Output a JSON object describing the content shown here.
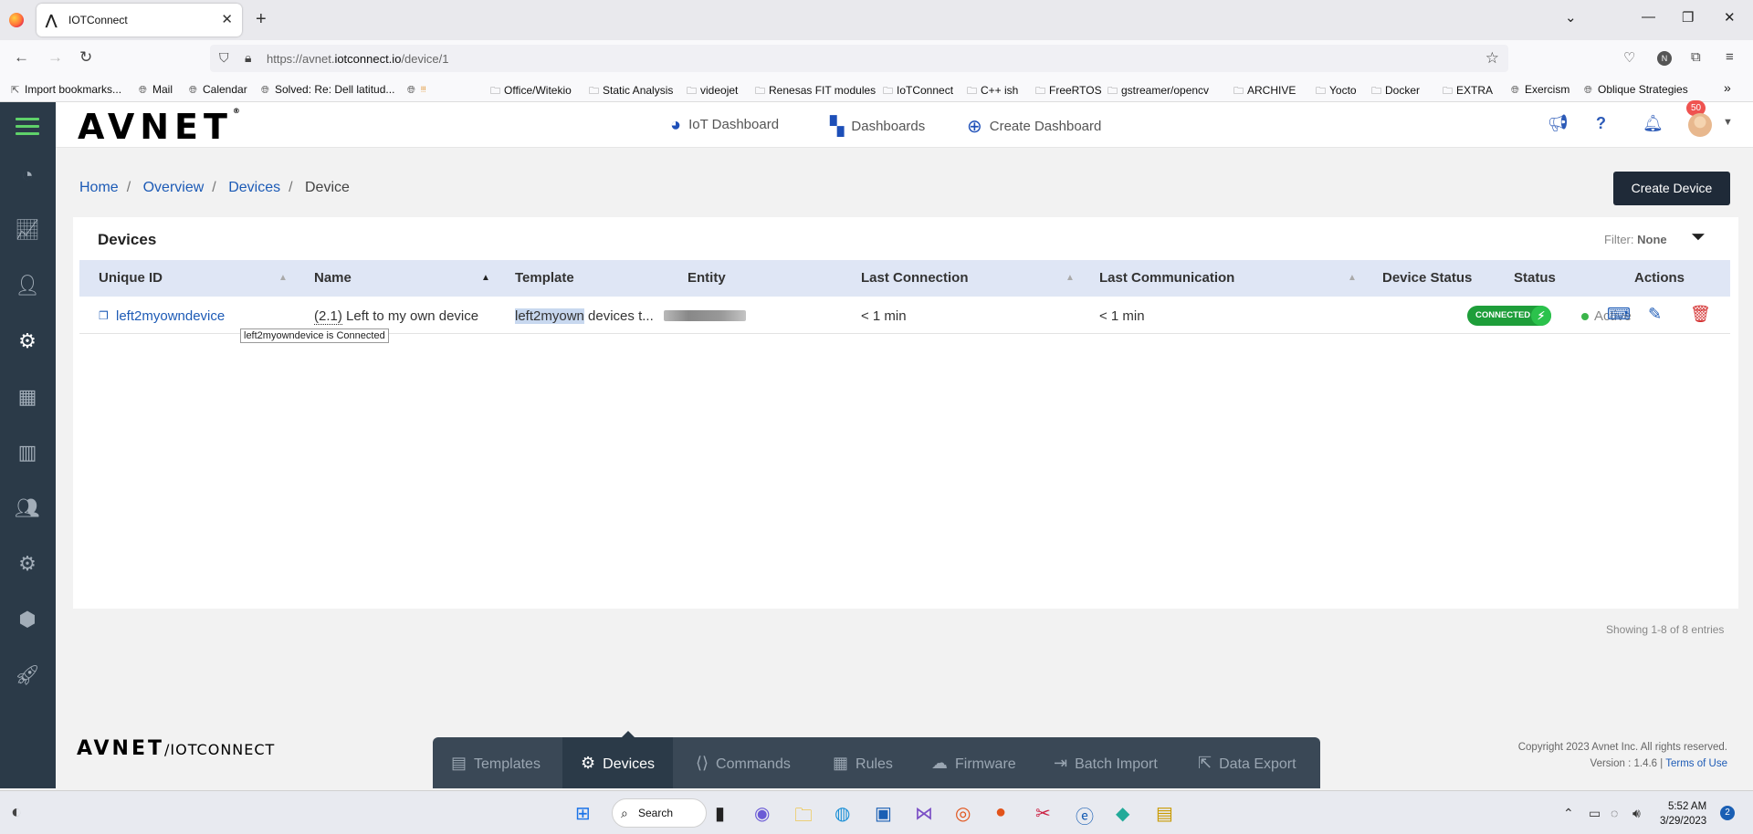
{
  "browser": {
    "tab_title": "IOTConnect",
    "url_prefix": "https://avnet.",
    "url_domain": "iotconnect.io",
    "url_path": "/device/1",
    "bookmarks": [
      {
        "label": "Import bookmarks...",
        "icon": "import-icon"
      },
      {
        "label": "Mail",
        "icon": "globe-icon"
      },
      {
        "label": "Calendar",
        "icon": "globe-icon"
      },
      {
        "label": "Solved: Re: Dell latitud...",
        "icon": "globe-icon"
      },
      {
        "label": "Office/Witekio",
        "icon": "folder-icon"
      },
      {
        "label": "Static Analysis",
        "icon": "folder-icon"
      },
      {
        "label": "videojet",
        "icon": "folder-icon"
      },
      {
        "label": "Renesas FIT modules",
        "icon": "folder-icon"
      },
      {
        "label": "IoTConnect",
        "icon": "folder-icon"
      },
      {
        "label": "C++ ish",
        "icon": "folder-icon"
      },
      {
        "label": "FreeRTOS",
        "icon": "folder-icon"
      },
      {
        "label": "gstreamer/opencv",
        "icon": "folder-icon"
      },
      {
        "label": "ARCHIVE",
        "icon": "folder-icon"
      },
      {
        "label": "Yocto",
        "icon": "folder-icon"
      },
      {
        "label": "Docker",
        "icon": "folder-icon"
      },
      {
        "label": "EXTRA",
        "icon": "folder-icon"
      },
      {
        "label": "Exercism",
        "icon": "globe-icon"
      },
      {
        "label": "Oblique Strategies",
        "icon": "globe-icon"
      }
    ]
  },
  "app": {
    "logo": "AVNET",
    "header_nav": [
      {
        "label": "IoT Dashboard",
        "icon": "gauge-icon"
      },
      {
        "label": "Dashboards",
        "icon": "dashboard-grid-icon"
      },
      {
        "label": "Create Dashboard",
        "icon": "plus-circle-icon"
      }
    ],
    "notification_count": "50",
    "breadcrumb": {
      "home": "Home",
      "overview": "Overview",
      "devices": "Devices",
      "current": "Device"
    },
    "create_button": "Create Device",
    "panel": {
      "title": "Devices",
      "filter_label": "Filter:",
      "filter_value": "None",
      "columns": [
        "Unique ID",
        "Name",
        "Template",
        "Entity",
        "Last Connection",
        "Last Communication",
        "Device Status",
        "Status",
        "Actions"
      ],
      "rows": [
        {
          "unique_id": "left2myowndevice",
          "name_prefix": "(2.1)",
          "name": " Left to my own device",
          "template_highlight": "left2myown",
          "template_rest": " devices t...",
          "last_connection": "< 1 min",
          "last_communication": "< 1 min",
          "device_status": "CONNECTED",
          "status": "Active"
        }
      ],
      "tooltip": "left2myowndevice is Connected"
    },
    "entries_text": "Showing 1-8 of 8 entries",
    "footer": {
      "logo": "AVNET",
      "logo_sub": "/IOTCONNECT",
      "copyright": "Copyright 2023 Avnet Inc. All rights reserved.",
      "version": "Version : 1.4.6 |",
      "terms": "Terms of Use"
    },
    "bottom_tabs": [
      {
        "label": "Templates",
        "icon": "template-icon",
        "active": false
      },
      {
        "label": "Devices",
        "icon": "chip-icon",
        "active": true
      },
      {
        "label": "Commands",
        "icon": "code-icon",
        "active": false
      },
      {
        "label": "Rules",
        "icon": "clipboard-icon",
        "active": false
      },
      {
        "label": "Firmware",
        "icon": "cloud-icon",
        "active": false
      },
      {
        "label": "Batch Import",
        "icon": "import-icon",
        "active": false
      },
      {
        "label": "Data Export",
        "icon": "export-icon",
        "active": false
      }
    ]
  },
  "taskbar": {
    "search": "Search",
    "time": "5:52 AM",
    "date": "3/29/2023",
    "notifications": "2"
  },
  "colors": {
    "sidebar": "#2b3a48",
    "accent_green": "#5fd16a",
    "link_blue": "#1d5bb6",
    "connected_green": "#1e9e3a",
    "delete_red": "#d32f2f"
  }
}
